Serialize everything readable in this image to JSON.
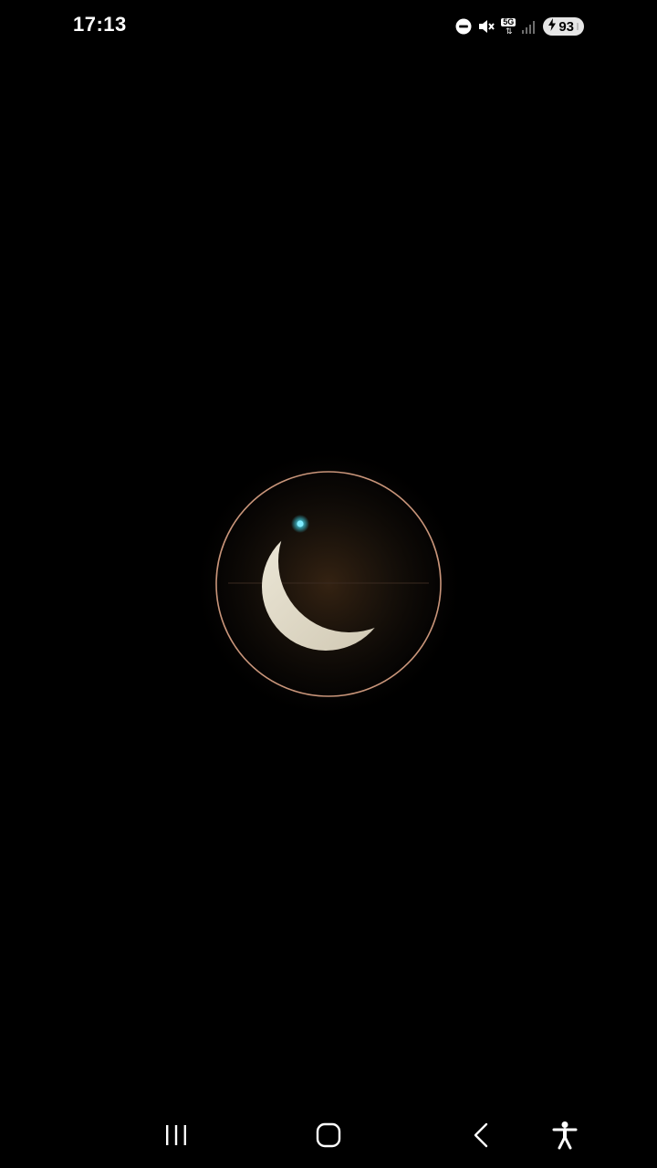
{
  "status_bar": {
    "time": "17:13",
    "network_label": "5G",
    "battery_level": "93",
    "icons": [
      "do-not-disturb-icon",
      "mute-icon",
      "5g-data-icon",
      "signal-icon",
      "battery-charging-icon"
    ]
  },
  "splash": {
    "logo_icon": "crescent-moon-icon",
    "colors": {
      "background": "#000000",
      "ring": "#c9957a",
      "moon": "#e4dfcf",
      "accent_dot": "#3fd2e6"
    }
  },
  "nav_bar": {
    "buttons": [
      "recent-apps",
      "home",
      "back",
      "accessibility"
    ]
  }
}
